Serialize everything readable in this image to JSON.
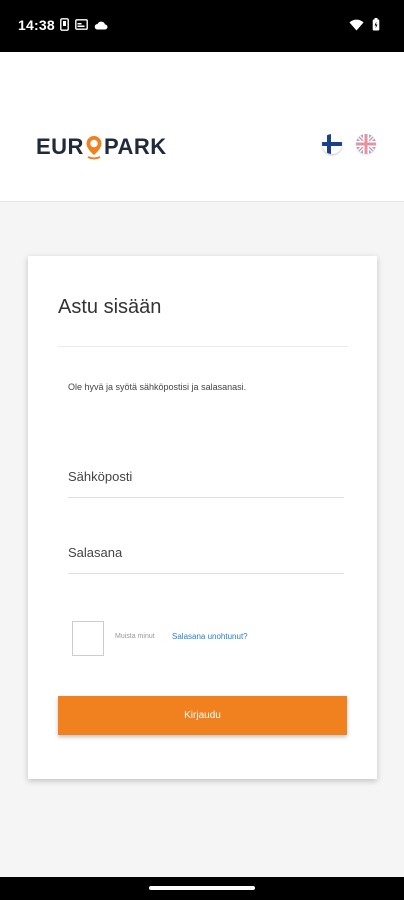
{
  "status_bar": {
    "time": "14:38",
    "left_icons": [
      "phone-icon",
      "card-icon",
      "cloud-icon"
    ],
    "right_icons": [
      "wifi-icon",
      "battery-icon"
    ]
  },
  "header": {
    "logo_left": "EUR",
    "logo_right": "PARK",
    "languages": [
      "fi",
      "en"
    ]
  },
  "login": {
    "title": "Astu sisään",
    "intro": "Ole hyvä ja syötä sähköpostisi ja salasanasi.",
    "email_placeholder": "Sähköposti",
    "password_placeholder": "Salasana",
    "remember_label": "Muista minut",
    "forgot_link": "Salasana unohtunut?",
    "submit_label": "Kirjaudu"
  },
  "colors": {
    "accent": "#f1811f",
    "link": "#2a7fd4",
    "logo_text": "#1f2a3a"
  }
}
